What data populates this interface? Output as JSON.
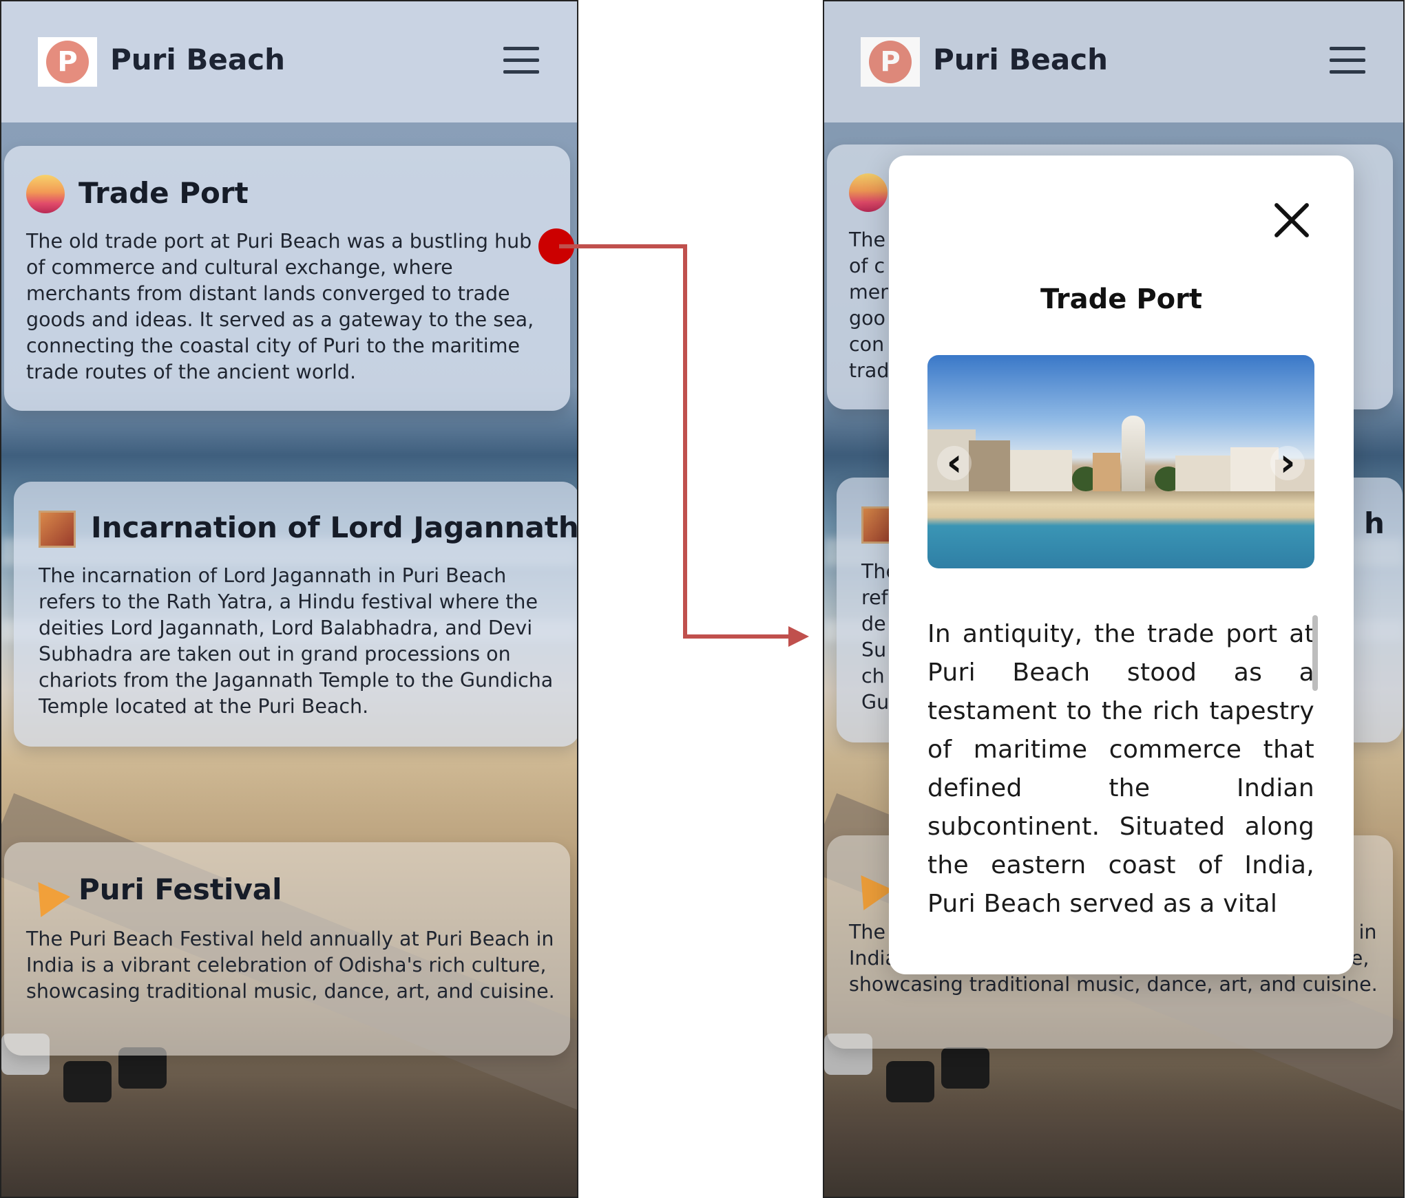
{
  "app": {
    "brand": "Puri Beach",
    "logo_letter": "P"
  },
  "cards": [
    {
      "title": "Trade Port",
      "body": "The old trade port at Puri Beach was a bustling hub of commerce and cultural exchange, where merchants from distant lands converged to trade goods and ideas. It served as a gateway to the sea, connecting the coastal city of Puri to the maritime trade routes of the ancient world."
    },
    {
      "title": "Incarnation of Lord Jagannath",
      "body": "The incarnation of Lord Jagannath in Puri Beach refers to the Rath Yatra, a Hindu festival where the deities Lord Jagannath, Lord Balabhadra, and Devi Subhadra are taken out in grand processions on chariots from the Jagannath Temple to the Gundicha Temple located at the Puri Beach."
    },
    {
      "title": "Puri Festival",
      "body": "The Puri Beach Festival held annually at Puri Beach in India is a vibrant celebration of Odisha's rich culture, showcasing traditional music, dance, art, and cuisine."
    }
  ],
  "right_cards": [
    {
      "body": "The\nof c\nmer\ngoo\ncon\ntrad"
    },
    {
      "title_tail": "h",
      "body": "The\nref\nde\nSu\nch\nGu"
    },
    {
      "body": "The Puri Beach Festival held annually at Puri Beach in India is a vibrant celebration of Odisha's rich culture, showcasing traditional music, dance, art, and cuisine."
    }
  ],
  "modal": {
    "title": "Trade Port",
    "text": "In antiquity, the trade port at Puri Beach stood as a testament to the rich tapestry of maritime commerce that defined the Indian subcontinent. Situated along the eastern coast of India, Puri Beach served as a vital",
    "prev_glyph": "‹",
    "next_glyph": "›"
  },
  "colors": {
    "accent_red": "#c0392b",
    "header_bg": "#c9d3e3",
    "logo": "#e58d7e"
  }
}
